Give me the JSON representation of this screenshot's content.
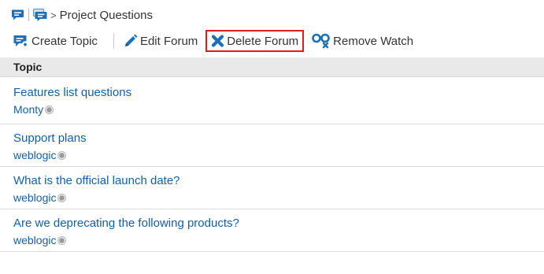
{
  "breadcrumb": {
    "separator": ">",
    "current": "Project Questions",
    "icons": [
      "forum-icon",
      "forums-icon"
    ]
  },
  "toolbar": {
    "create_topic": "Create Topic",
    "edit_forum": "Edit Forum",
    "delete_forum": "Delete Forum",
    "remove_watch": "Remove Watch"
  },
  "table": {
    "column_header": "Topic"
  },
  "topics": [
    {
      "title": "Features list questions",
      "author": "Monty"
    },
    {
      "title": "Support plans",
      "author": "weblogic"
    },
    {
      "title": "What is the official launch date?",
      "author": "weblogic"
    },
    {
      "title": "Are we deprecating the following products?",
      "author": "weblogic"
    }
  ],
  "colors": {
    "icon_blue": "#1c6fb9",
    "link": "#145fa8",
    "highlight_border": "#e01b1b",
    "header_bg": "#e9e9e9"
  }
}
